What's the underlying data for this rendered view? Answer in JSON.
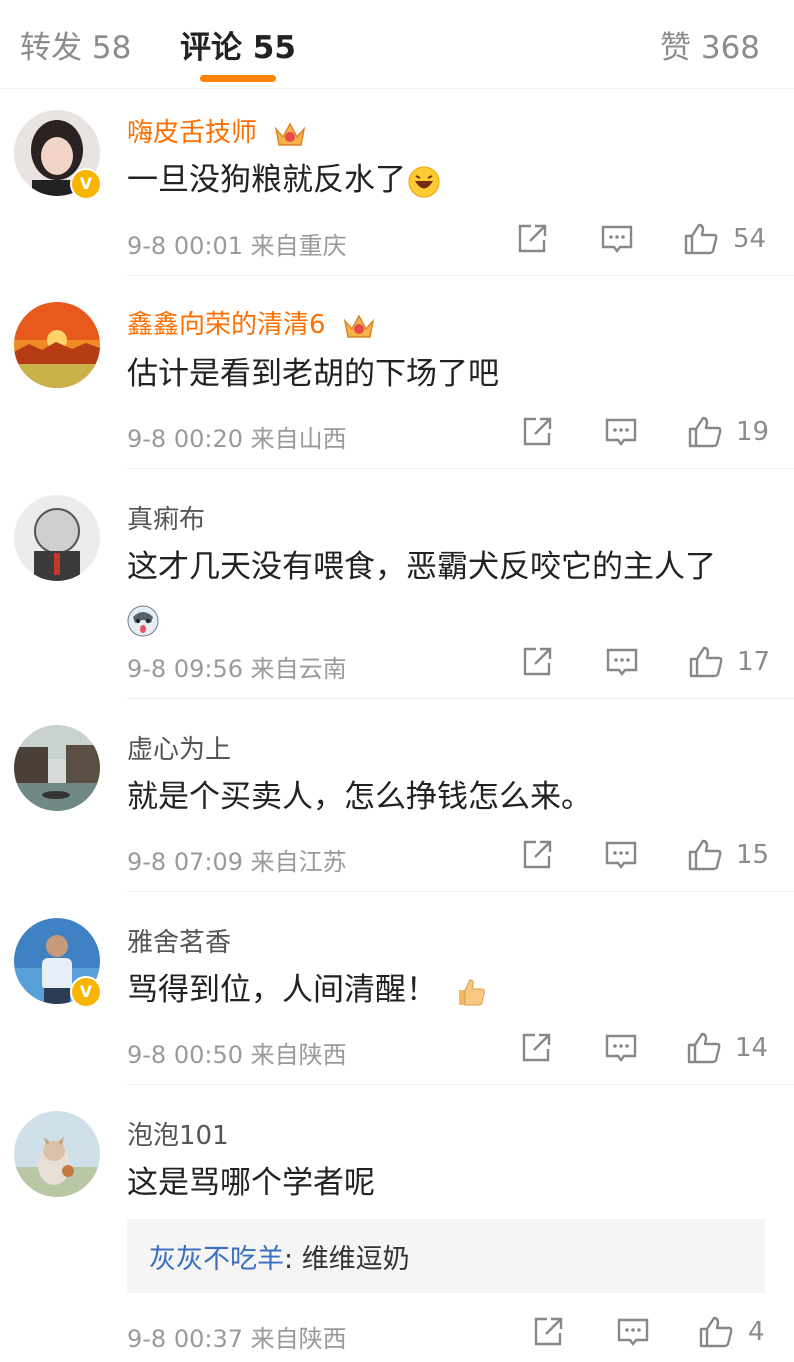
{
  "tabs": {
    "repost": "转发 58",
    "comments": "评论 55",
    "likes": "赞 368"
  },
  "colors": {
    "accent": "#ff8200",
    "vip_name": "#ff6f00",
    "link": "#3b6fc1"
  },
  "comments": [
    {
      "user": "嗨皮舌技师",
      "vip": true,
      "verified": true,
      "text": "一旦没狗粮就反水了",
      "emoji": "laughing-emoji",
      "time": "9-8 00:01",
      "location": "来自重庆",
      "likes": "54"
    },
    {
      "user": "鑫鑫向荣的清清6",
      "vip": true,
      "verified": false,
      "text": "估计是看到老胡的下场了吧",
      "time": "9-8 00:20",
      "location": "来自山西",
      "likes": "19"
    },
    {
      "user": "真痢布",
      "vip": false,
      "verified": false,
      "text": "这才几天没有喂食，恶霸犬反咬它的主人了",
      "emoji": "husky-emoji",
      "time": "9-8 09:56",
      "location": "来自云南",
      "likes": "17"
    },
    {
      "user": "虚心为上",
      "vip": false,
      "verified": false,
      "text": "就是个买卖人，怎么挣钱怎么来。",
      "time": "9-8 07:09",
      "location": "来自江苏",
      "likes": "15"
    },
    {
      "user": "雅舍茗香",
      "vip": false,
      "verified": true,
      "text": "骂得到位，人间清醒！",
      "emoji": "thumbs-up-emoji",
      "time": "9-8 00:50",
      "location": "来自陕西",
      "likes": "14"
    },
    {
      "user": "泡泡101",
      "vip": false,
      "verified": false,
      "text": "这是骂哪个学者呢",
      "time": "9-8 00:37",
      "location": "来自陕西",
      "likes": "4",
      "reply": {
        "user": "灰灰不吃羊",
        "separator": ": ",
        "text": "维维逗奶"
      }
    }
  ]
}
